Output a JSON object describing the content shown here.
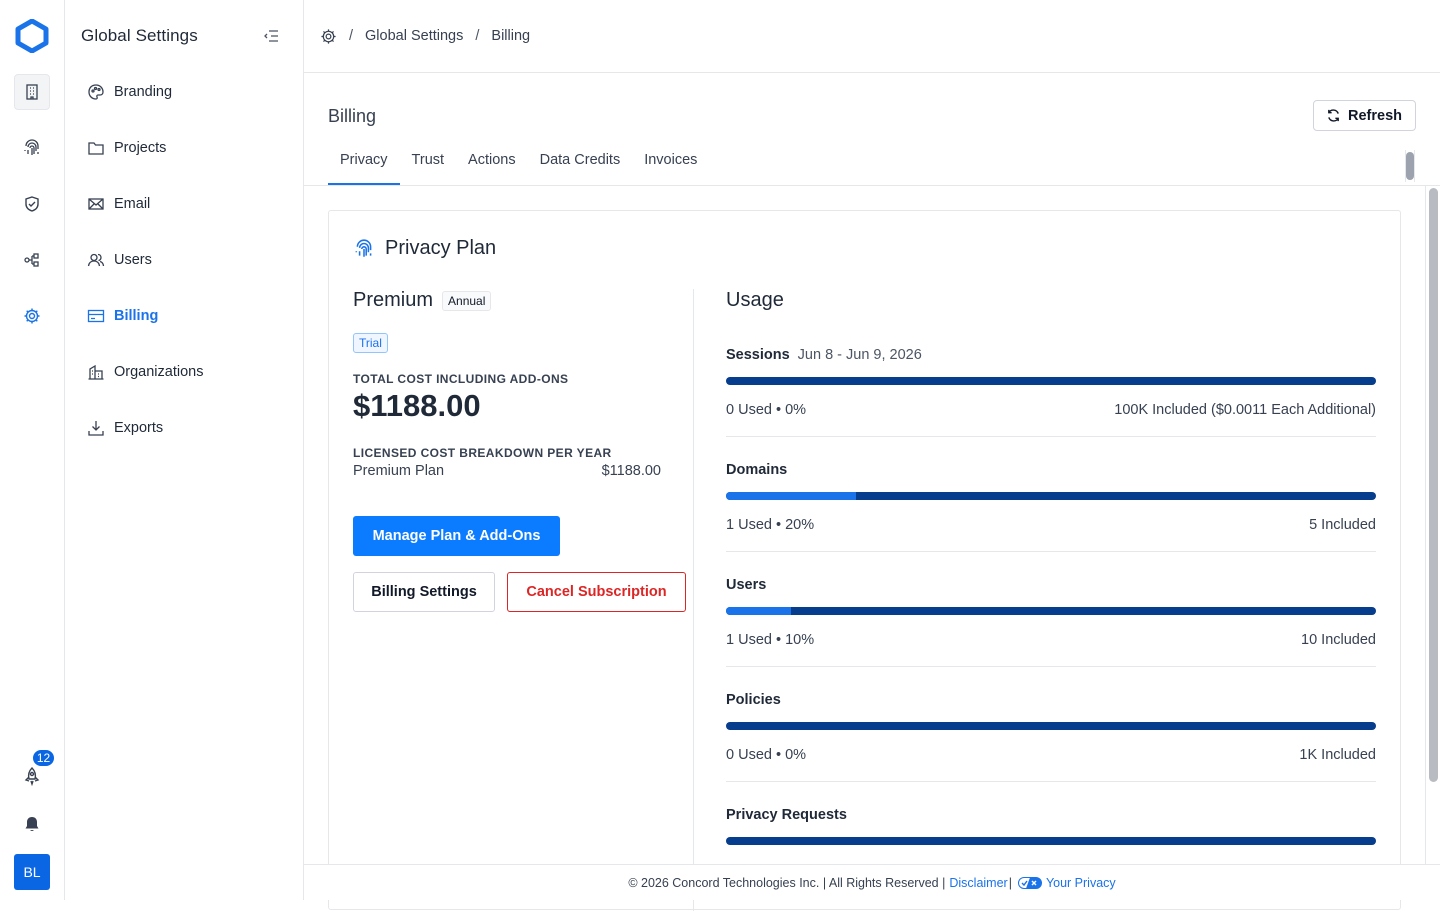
{
  "rail": {
    "items": [
      {
        "icon": "building-icon",
        "selected": true
      },
      {
        "icon": "fingerprint-icon"
      },
      {
        "icon": "shield-check-icon"
      },
      {
        "icon": "workflow-icon"
      },
      {
        "icon": "gear-icon",
        "active": true
      }
    ],
    "notification_count": "12",
    "avatar_initials": "BL"
  },
  "sidebar": {
    "title": "Global Settings",
    "items": [
      {
        "label": "Branding",
        "icon": "palette-icon"
      },
      {
        "label": "Projects",
        "icon": "folder-icon"
      },
      {
        "label": "Email",
        "icon": "mail-icon"
      },
      {
        "label": "Users",
        "icon": "users-icon"
      },
      {
        "label": "Billing",
        "icon": "credit-card-icon",
        "active": true
      },
      {
        "label": "Organizations",
        "icon": "organization-icon"
      },
      {
        "label": "Exports",
        "icon": "download-icon"
      }
    ]
  },
  "breadcrumb": {
    "items": [
      "Global Settings",
      "Billing"
    ],
    "separator": "/"
  },
  "page": {
    "title": "Billing",
    "refresh_label": "Refresh",
    "tabs": [
      {
        "label": "Privacy",
        "active": true
      },
      {
        "label": "Trust"
      },
      {
        "label": "Actions"
      },
      {
        "label": "Data Credits"
      },
      {
        "label": "Invoices"
      }
    ]
  },
  "card": {
    "title": "Privacy Plan",
    "plan_name": "Premium",
    "billing_period": "Annual",
    "trial_label": "Trial",
    "total_cost_caption": "TOTAL COST INCLUDING ADD-ONS",
    "total_cost": "$1188.00",
    "breakdown_caption": "LICENSED COST BREAKDOWN PER YEAR",
    "breakdown": [
      {
        "item": "Premium Plan",
        "amount": "$1188.00"
      }
    ],
    "manage_label": "Manage Plan & Add-Ons",
    "billing_settings_label": "Billing Settings",
    "cancel_label": "Cancel Subscription"
  },
  "usage": {
    "title": "Usage",
    "metrics": [
      {
        "label": "Sessions",
        "period": "Jun 8 - Jun 9, 2026",
        "used": "0 Used • 0%",
        "included": "100K Included ($0.0011 Each Additional)",
        "percent": 0
      },
      {
        "label": "Domains",
        "period": "",
        "used": "1 Used • 20%",
        "included": "5 Included",
        "percent": 20
      },
      {
        "label": "Users",
        "period": "",
        "used": "1 Used • 10%",
        "included": "10 Included",
        "percent": 10
      },
      {
        "label": "Policies",
        "period": "",
        "used": "0 Used • 0%",
        "included": "1K Included",
        "percent": 0
      },
      {
        "label": "Privacy Requests",
        "period": "",
        "used": "",
        "included": "",
        "percent": 0
      }
    ]
  },
  "footer": {
    "copyright": "© 2026 Concord Technologies Inc. | All Rights Reserved |",
    "disclaimer": "Disclaimer",
    "privacy": "Your Privacy"
  },
  "colors": {
    "accent": "#1a73e8",
    "primary_button": "#0b7bff",
    "bar_track": "#063d8c",
    "danger": "#dc2626"
  }
}
